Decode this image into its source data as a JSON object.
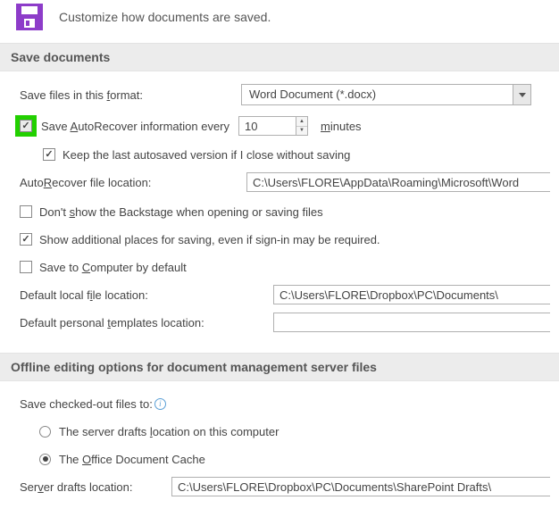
{
  "header": {
    "text": "Customize how documents are saved."
  },
  "save_documents": {
    "title": "Save documents",
    "format_label_pre": "Save files in this ",
    "format_label_u": "f",
    "format_label_post": "ormat:",
    "format_value": "Word Document (*.docx)",
    "autorecover_pre": "Save ",
    "autorecover_u": "A",
    "autorecover_post": "utoRecover information every",
    "autorecover_value": "10",
    "autorecover_unit_u": "m",
    "autorecover_unit_post": "inutes",
    "keep_last": "Keep the last autosaved version if I close without saving",
    "ar_loc_pre": "Auto",
    "ar_loc_u": "R",
    "ar_loc_post": "ecover file location:",
    "ar_loc_value": "C:\\Users\\FLORE\\AppData\\Roaming\\Microsoft\\Word",
    "backstage_pre": "Don't ",
    "backstage_u": "s",
    "backstage_post": "how the Backstage when opening or saving files",
    "additional_places": "Show additional places for saving, even if sign-in may be required.",
    "save_computer_pre": "Save to ",
    "save_computer_u": "C",
    "save_computer_post": "omputer by default",
    "def_local_pre": "Default local f",
    "def_local_u": "i",
    "def_local_post": "le location:",
    "def_local_value": "C:\\Users\\FLORE\\Dropbox\\PC\\Documents\\",
    "def_tmpl_pre": "Default personal ",
    "def_tmpl_u": "t",
    "def_tmpl_post": "emplates location:",
    "def_tmpl_value": ""
  },
  "offline": {
    "title": "Offline editing options for document management server files",
    "save_checked_out": "Save checked-out files to:",
    "radio1_pre": "The server drafts ",
    "radio1_u": "l",
    "radio1_post": "ocation on this computer",
    "radio2_pre": "The ",
    "radio2_u": "O",
    "radio2_post": "ffice Document Cache",
    "server_drafts_pre": "Ser",
    "server_drafts_u": "v",
    "server_drafts_post": "er drafts location:",
    "server_drafts_value": "C:\\Users\\FLORE\\Dropbox\\PC\\Documents\\SharePoint Drafts\\"
  }
}
